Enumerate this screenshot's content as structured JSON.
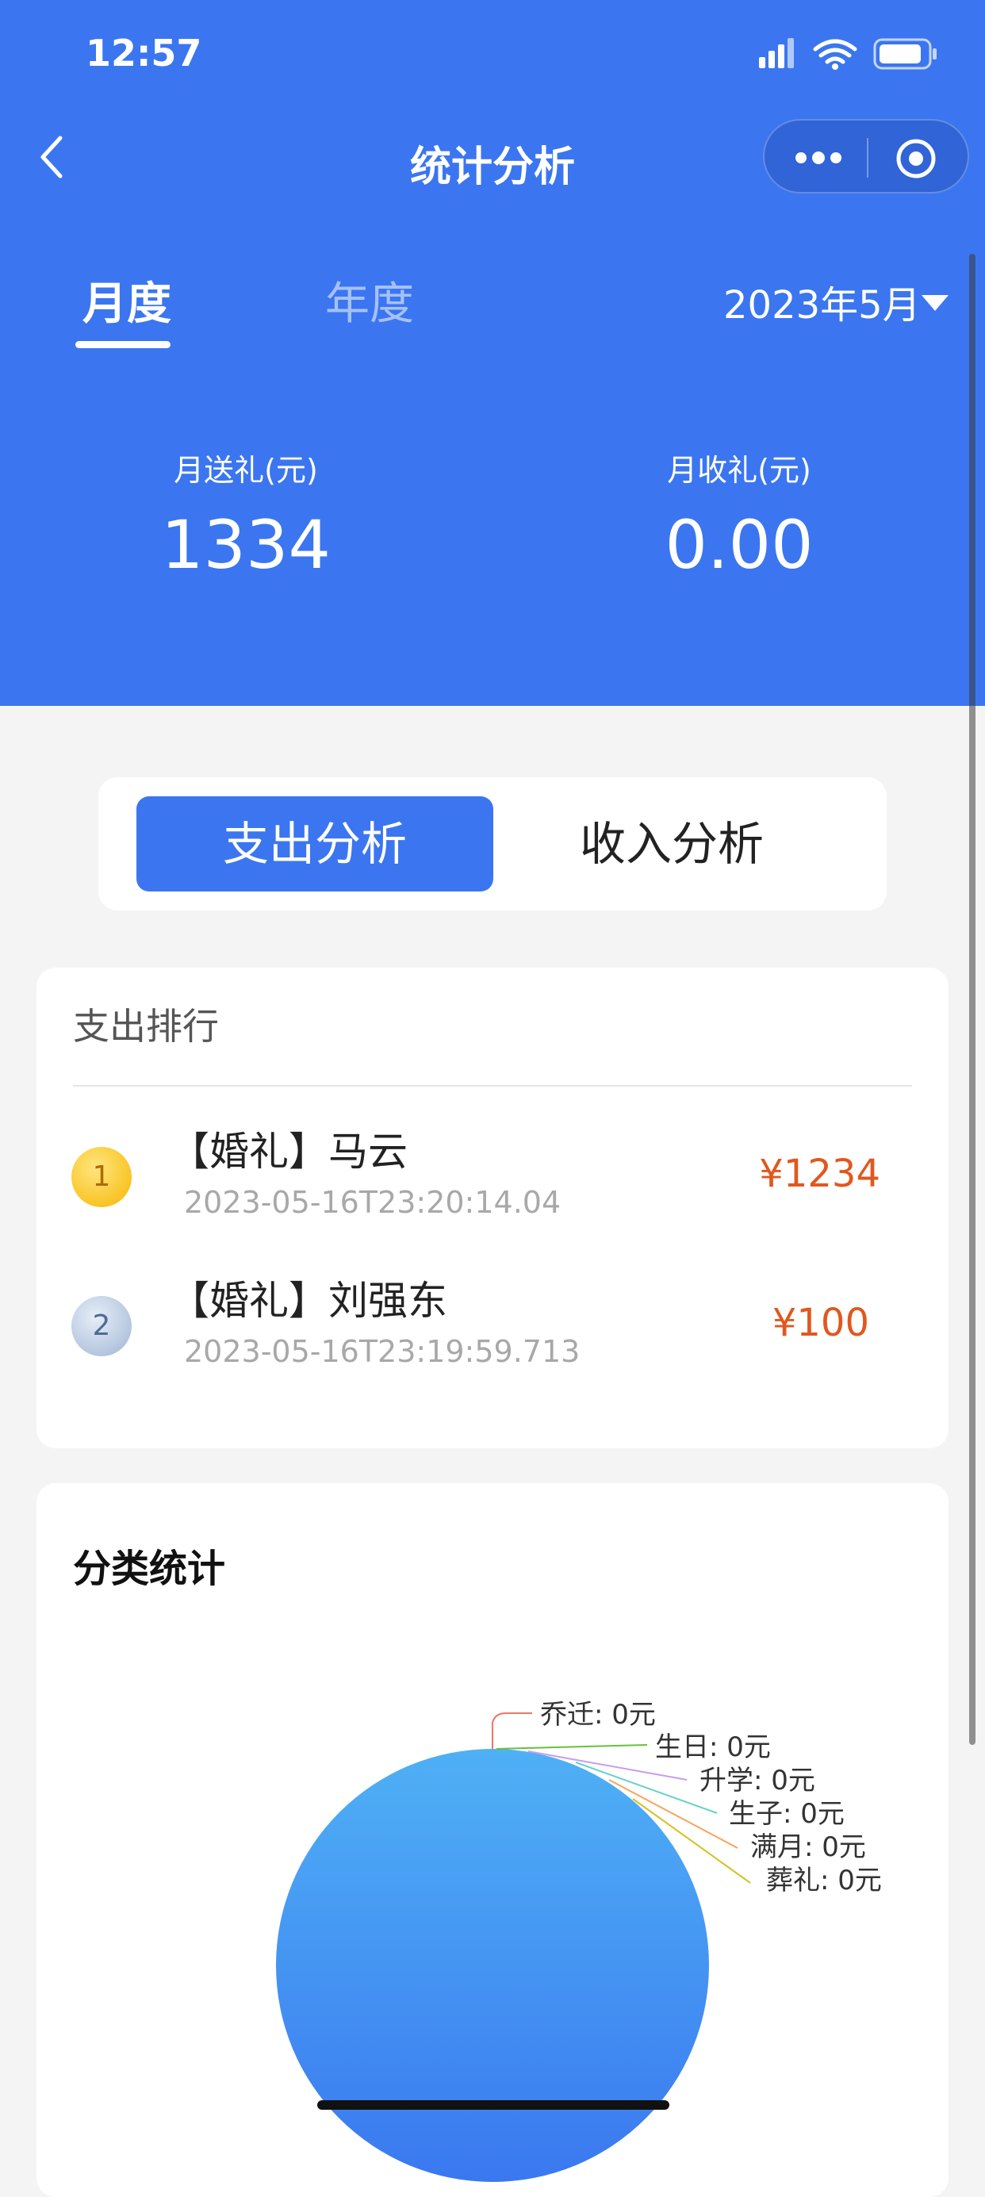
{
  "status_bar": {
    "time": "12:57"
  },
  "nav": {
    "title": "统计分析"
  },
  "period_tabs": {
    "monthly": "月度",
    "yearly": "年度"
  },
  "date_picker": {
    "value": "2023年5月"
  },
  "summary": {
    "sent_label": "月送礼(元)",
    "sent_value": "1334",
    "received_label": "月收礼(元)",
    "received_value": "0.00"
  },
  "segments": {
    "expense": "支出分析",
    "income": "收入分析"
  },
  "ranking": {
    "title": "支出排行",
    "items": [
      {
        "rank": "1",
        "name": "【婚礼】马云",
        "time": "2023-05-16T23:20:14.04",
        "amount": "¥1234"
      },
      {
        "rank": "2",
        "name": "【婚礼】刘强东",
        "time": "2023-05-16T23:19:59.713",
        "amount": "¥100"
      }
    ]
  },
  "category": {
    "title": "分类统计",
    "labels": [
      {
        "text": "乔迁: 0元",
        "color": "#ee7766"
      },
      {
        "text": "生日: 0元",
        "color": "#66c23a"
      },
      {
        "text": "升学: 0元",
        "color": "#c79cf0"
      },
      {
        "text": "生子: 0元",
        "color": "#66d2c8"
      },
      {
        "text": "满月: 0元",
        "color": "#f5a55c"
      },
      {
        "text": "葬礼: 0元",
        "color": "#d4c21e"
      }
    ]
  },
  "colors": {
    "primary": "#3b76f0",
    "amount": "#e0581e",
    "pie_top": "#4fb0f5",
    "pie_bottom": "#3a78f0"
  }
}
